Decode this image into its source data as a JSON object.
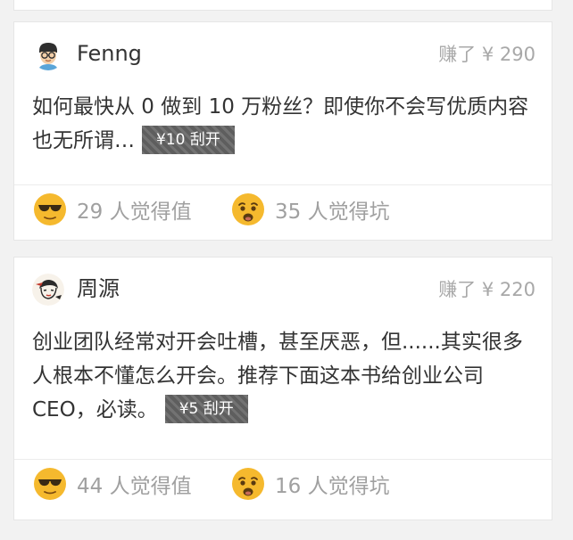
{
  "posts": [
    {
      "author": "Fenng",
      "earned": "赚了 ¥ 290",
      "content": "如何最快从 0 做到 10 万粉丝？即使你不会写优质内容也无所谓…",
      "scratch_label": "¥10 刮开",
      "worth_label": "29 人觉得值",
      "pit_label": "35 人觉得坑",
      "avatar_icon": "cartoon-man-with-glasses-avatar"
    },
    {
      "author": "周源",
      "earned": "赚了 ¥ 220",
      "content": "创业团队经常对开会吐槽，甚至厌恶，但......其实很多人根本不懂怎么开会。推荐下面这本书给创业公司 CEO，必读。",
      "scratch_label": "¥5 刮开",
      "worth_label": "44 人觉得值",
      "pit_label": "16 人觉得坑",
      "avatar_icon": "sketch-portrait-avatar"
    }
  ],
  "icons": {
    "worth": "cool-sunglasses-emoji-icon",
    "pit": "shocked-emoji-icon"
  },
  "colors": {
    "background": "#f2f2f2",
    "card": "#ffffff",
    "text": "#333333",
    "muted": "#a0a0a0",
    "scratch_bg": "#5e5e5e",
    "emoji_yellow": "#f5b92e"
  }
}
